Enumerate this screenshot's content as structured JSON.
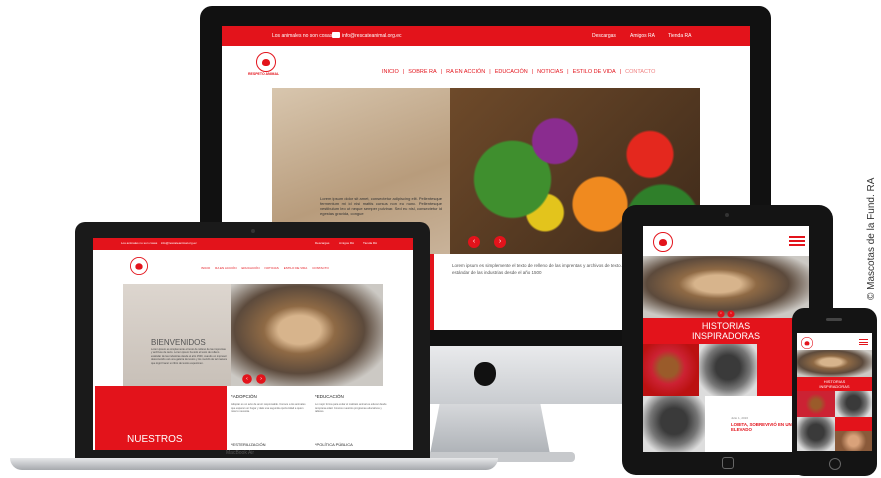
{
  "imac": {
    "topbar_text": "Los animales no son cosas",
    "email": "info@rescateanimal.org.ec",
    "topbar_links": [
      "Descargas",
      "Amigos RA",
      "Tienda RA"
    ],
    "logo_text": "RESPETO ANIMAL",
    "nav": [
      "INICIO",
      "SOBRE RA",
      "RA EN ACCIÓN",
      "EDUCACIÓN",
      "NOTICIAS",
      "ESTILO DE VIDA",
      "CONTACTO"
    ],
    "nav_sep": "|",
    "hero_text": "Lorem ipsum dolor sit amet, consectetur adipiscing elit. Pellentesque fermentum mi id nisi mattis cursus non eu nunc. Pellentesque vestibulum leo ut neque semper pulvinar. Sed eu nisl, consectetur id egestas gravida, congue",
    "below_text": "Lorem ipsum es simplemente el texto de relleno de las imprentas y archivos de texto. Lorem ipsum ha sido el texto de relleno estándar de las industrias desde el año 1500"
  },
  "laptop": {
    "brand": "MacBook Air",
    "hero_title": "BIENVENIDOS",
    "hero_text": "Lorem ipsum es simplemente el texto de relleno de las imprentas y archivos de texto. Lorem ipsum ha sido el texto de relleno estándar de las industrias desde el año 1500, cuando un impresor desconocido usó una galería de textos y los mezcló de tal manera que logró hacer un libro de textos especimen.",
    "col1_title": "*ADOPCIÓN",
    "col1_text": "Adoptar es un acto de amor responsable. Conoce a los animales que esperan un hogar y dale una segunda oportunidad a quien más lo necesita.",
    "col2_title": "*EDUCACIÓN",
    "col2_text": "Lo mejor forma para evitar el maltrato animal es educar desde temprana edad. Conoce nuestros programas educativos y talleres.",
    "red_title": "NUESTROS",
    "col1b_title": "*ESTERILIZACIÓN",
    "col2b_title": "*POLÍTICA PÚBLICA"
  },
  "tablet": {
    "banner_line1": "HISTORIAS",
    "banner_line2": "INSPIRADORAS",
    "story_date": "Julio 1, 2016",
    "story_title": "LOBITA, SOBREVIVIÓ EN UN PASO ELEVADO"
  },
  "phone": {
    "banner_line1": "HISTORIAS",
    "banner_line2": "INSPIRADORAS"
  },
  "side_text": "© Mascotas de la Fund. RA",
  "icons": {
    "apple": "apple-logo-icon",
    "prev": "chevron-left-icon",
    "next": "chevron-right-icon",
    "menu": "hamburger-menu-icon",
    "email": "envelope-icon"
  },
  "colors": {
    "brand_red": "#e3131b"
  }
}
